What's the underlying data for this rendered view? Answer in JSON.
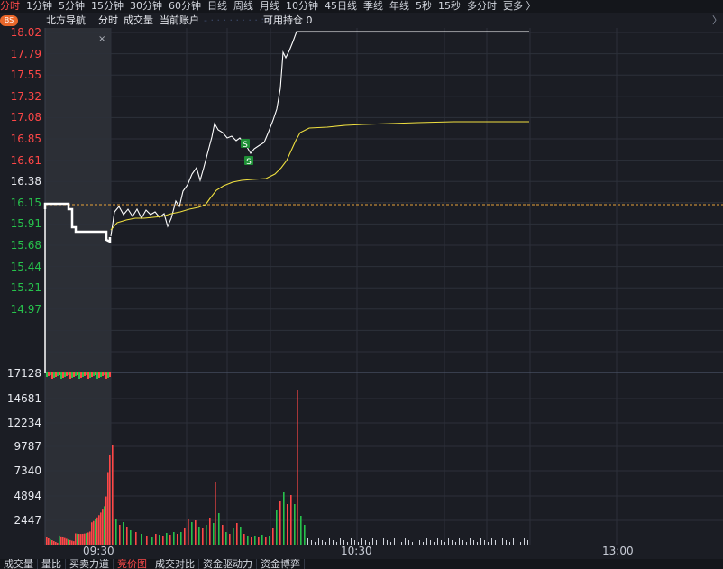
{
  "periods": [
    "分时",
    "1分钟",
    "5分钟",
    "15分钟",
    "30分钟",
    "60分钟",
    "日线",
    "周线",
    "月线",
    "10分钟",
    "45日线",
    "季线",
    "年线",
    "5秒",
    "15秒",
    "多分时",
    "更多 〉"
  ],
  "active_period": "分时",
  "header": {
    "badge": "BS",
    "title": "北方导航",
    "mode": "分时",
    "volume_label": "成交量",
    "account_label": "当前账户",
    "account_value": "- · · · · · · · · :::",
    "holding_label": "可用持仓 0",
    "arrow": "〉"
  },
  "close_glyph": "×",
  "price_axis": [
    {
      "label": "18.02",
      "kind": "up"
    },
    {
      "label": "17.79",
      "kind": "up"
    },
    {
      "label": "17.55",
      "kind": "up"
    },
    {
      "label": "17.32",
      "kind": "up"
    },
    {
      "label": "17.08",
      "kind": "up"
    },
    {
      "label": "16.85",
      "kind": "up"
    },
    {
      "label": "16.61",
      "kind": "up"
    },
    {
      "label": "16.38",
      "kind": "mid"
    },
    {
      "label": "16.15",
      "kind": "down"
    },
    {
      "label": "15.91",
      "kind": "down"
    },
    {
      "label": "15.68",
      "kind": "down"
    },
    {
      "label": "15.44",
      "kind": "down"
    },
    {
      "label": "15.21",
      "kind": "down"
    },
    {
      "label": "14.97",
      "kind": "down"
    }
  ],
  "volume_axis": [
    "17128",
    "14681",
    "12234",
    "9787",
    "7340",
    "4894",
    "2447"
  ],
  "time_axis": [
    "09:30",
    "10:30",
    "13:00"
  ],
  "sell_marker": "S",
  "bottom_tabs": [
    "成交量",
    "量比",
    "买卖力道",
    "竞价图",
    "成交对比",
    "资金驱动力",
    "资金博弈"
  ],
  "active_bottom_tab": "竞价图",
  "colors": {
    "background": "#1b1d24",
    "up": "#ff4747",
    "down": "#27c24c",
    "price_line": "#ffffff",
    "avg_line": "#f0e040",
    "ref_line": "#e8a33a",
    "auction_shade": "#2c2f36",
    "grid": "#2c303a"
  }
}
